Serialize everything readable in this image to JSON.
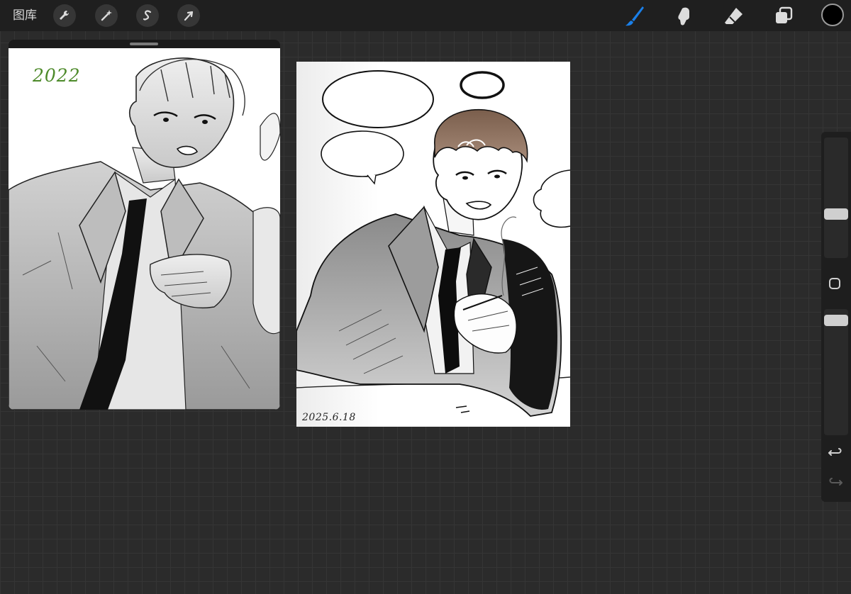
{
  "toolbar": {
    "gallery_label": "图库",
    "left_tools": [
      {
        "name": "actions",
        "icon": "wrench-icon"
      },
      {
        "name": "adjustments",
        "icon": "magic-wand-icon"
      },
      {
        "name": "selection",
        "icon": "selection-s-icon"
      },
      {
        "name": "transform",
        "icon": "arrow-cursor-icon"
      }
    ],
    "right_tools": [
      {
        "name": "brush",
        "icon": "brush-icon",
        "active": true
      },
      {
        "name": "smudge",
        "icon": "smudge-icon"
      },
      {
        "name": "eraser",
        "icon": "eraser-icon"
      },
      {
        "name": "layers",
        "icon": "layers-icon"
      }
    ],
    "active_color": "#000000",
    "active_tool_color": "#1a7fe8"
  },
  "sidebar": {
    "brush_size_slider": {
      "icon": "size-slider-handle"
    },
    "modify_button": {
      "icon": "square-modify-icon"
    },
    "opacity_slider": {
      "icon": "opacity-slider-handle"
    },
    "undo": {
      "icon": "undo-icon"
    },
    "redo": {
      "icon": "redo-icon",
      "enabled": false
    }
  },
  "reference_window": {
    "year_annotation": "2022"
  },
  "canvas": {
    "signature": "2025.6.18"
  }
}
